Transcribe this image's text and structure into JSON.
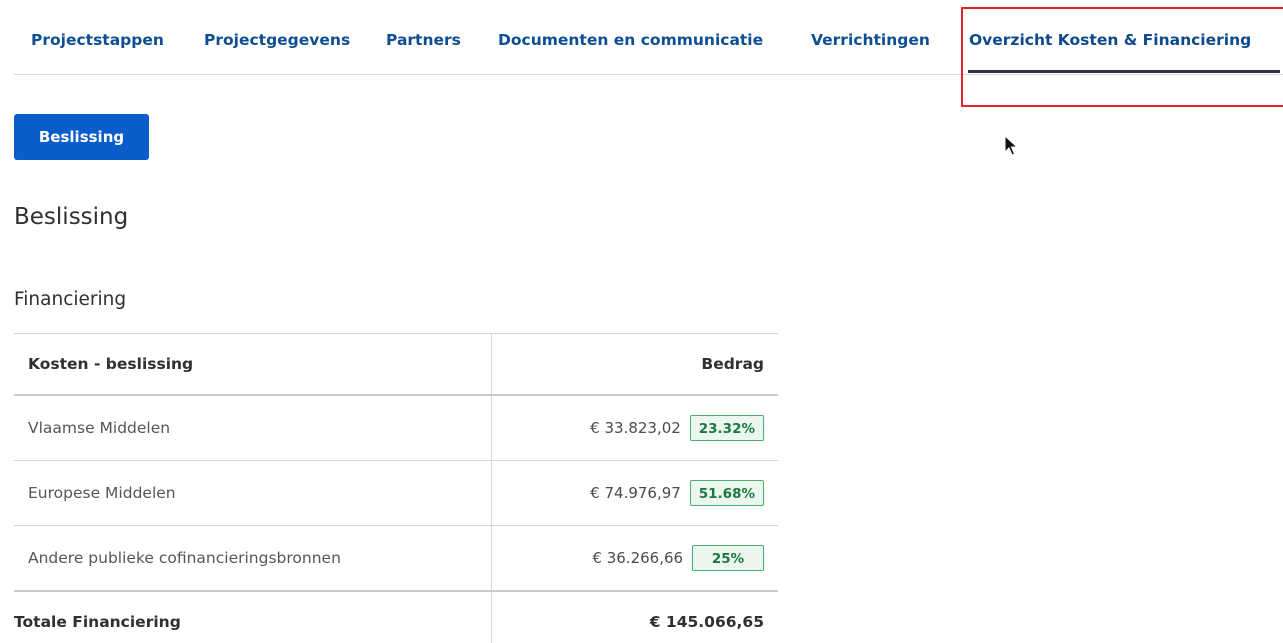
{
  "tabs": [
    {
      "label": "Projectstappen"
    },
    {
      "label": "Projectgegevens"
    },
    {
      "label": "Partners"
    },
    {
      "label": "Documenten en communicatie"
    },
    {
      "label": "Verrichtingen"
    },
    {
      "label": "Overzicht Kosten & Financiering"
    }
  ],
  "active_tab_index": 5,
  "button": {
    "label": "Beslissing"
  },
  "section_title": "Beslissing",
  "subsection_title": "Financiering",
  "table": {
    "headers": {
      "label": "Kosten - beslissing",
      "amount": "Bedrag"
    },
    "rows": [
      {
        "label": "Vlaamse Middelen",
        "amount": "€  33.823,02",
        "percent": "23.32%"
      },
      {
        "label": "Europese Middelen",
        "amount": "€  74.976,97",
        "percent": "51.68%"
      },
      {
        "label": "Andere publieke cofinancieringsbronnen",
        "amount": "€  36.266,66",
        "percent": "25%"
      }
    ],
    "total": {
      "label": "Totale Financiering",
      "amount": "€  145.066,65"
    }
  },
  "colors": {
    "tab_text": "#0e4f93",
    "button_bg": "#0b5dcb",
    "highlight_border": "#e0252d",
    "percent_badge_border": "#4caf6e",
    "percent_badge_text": "#1d7a3f"
  }
}
